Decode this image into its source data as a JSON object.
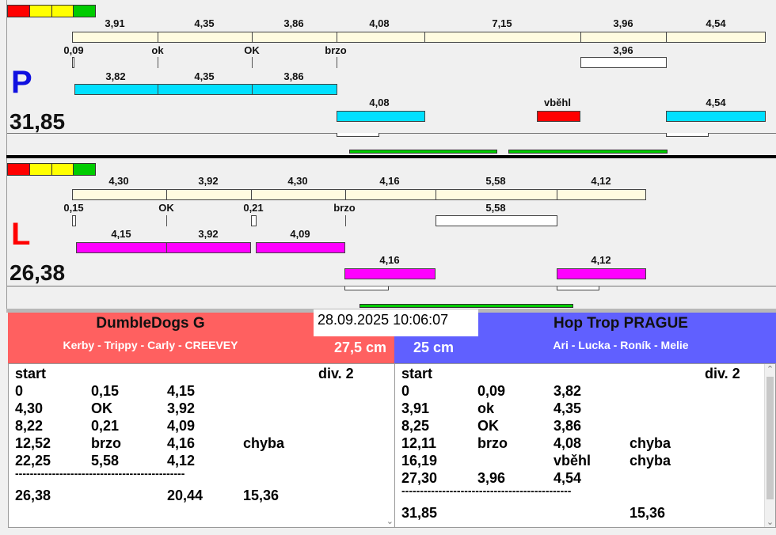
{
  "colors": {
    "seg_fill": "#fffbe0",
    "p_fill": "#00e0ff",
    "l_fill": "#ff00ff",
    "error": "#ff0000",
    "ok": "#00cc00",
    "left_hdr": "#ff6060",
    "right_hdr": "#6060ff"
  },
  "timestamp": "28.09.2025 10:06:07",
  "top": {
    "side": "P",
    "total": "31,85",
    "row1_labels": [
      "3,91",
      "4,35",
      "3,86",
      "4,08",
      "7,15",
      "3,96",
      "4,54"
    ],
    "row2_labels": [
      "0,09",
      "ok",
      "OK",
      "brzo",
      "3,96"
    ],
    "row3_labels": [
      "3,82",
      "4,35",
      "3,86"
    ],
    "row4_labels": [
      "4,08",
      "vběhl",
      "4,54"
    ]
  },
  "bottom": {
    "side": "L",
    "total": "26,38",
    "row1_labels": [
      "4,30",
      "3,92",
      "4,30",
      "4,16",
      "5,58",
      "4,12"
    ],
    "row2_labels": [
      "0,15",
      "OK",
      "0,21",
      "brzo",
      "5,58"
    ],
    "row3_labels": [
      "4,15",
      "3,92",
      "4,09"
    ],
    "row4_labels": [
      "4,16",
      "4,12"
    ]
  },
  "left_panel": {
    "team": "DumbleDogs G",
    "handlers": "Kerby - Trippy - Carly - CREEVEY",
    "height": "27,5 cm",
    "header_row": {
      "a": "start",
      "b": "div. 2"
    },
    "rows": [
      [
        "0",
        "0,15",
        "4,15",
        ""
      ],
      [
        "4,30",
        "OK",
        "3,92",
        ""
      ],
      [
        "8,22",
        "0,21",
        "4,09",
        ""
      ],
      [
        "12,52",
        "brzo",
        "4,16",
        "chyba"
      ],
      [
        "22,25",
        "5,58",
        "4,12",
        ""
      ]
    ],
    "separator": "----------------------------------------------",
    "summary": [
      "26,38",
      "",
      "20,44",
      "15,36"
    ]
  },
  "right_panel": {
    "team": "Hop Trop PRAGUE",
    "handlers": "Ari - Lucka - Roník - Melie",
    "height": "25 cm",
    "header_row": {
      "a": "start",
      "b": "div. 2"
    },
    "rows": [
      [
        "0",
        "0,09",
        "3,82",
        ""
      ],
      [
        "3,91",
        "ok",
        "4,35",
        ""
      ],
      [
        "8,25",
        "OK",
        "3,86",
        ""
      ],
      [
        "12,11",
        "brzo",
        "4,08",
        "chyba"
      ],
      [
        "16,19",
        "",
        "vběhl",
        "chyba"
      ],
      [
        "27,30",
        "3,96",
        "4,54",
        ""
      ]
    ],
    "separator": "----------------------------------------------",
    "summary": [
      "31,85",
      "",
      "",
      "15,36"
    ]
  }
}
